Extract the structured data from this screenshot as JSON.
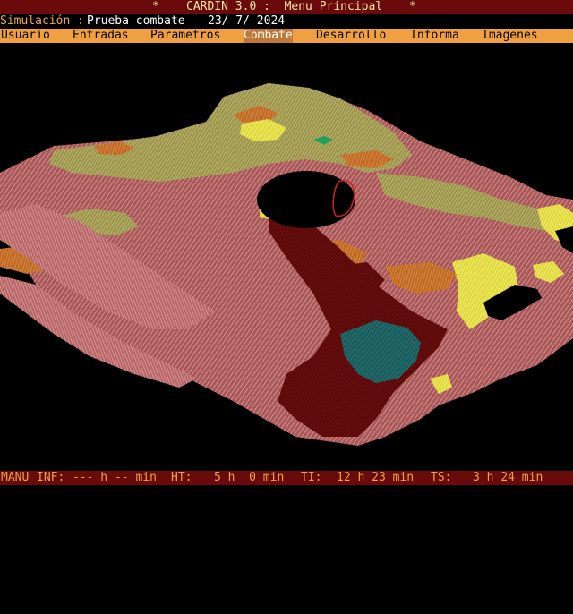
{
  "title_bar": {
    "left_marker": "*",
    "title": "CARDIN 3.0 :  Menu Principal",
    "right_marker": "*"
  },
  "simulation": {
    "label": "Simulación :",
    "name": "Prueba combate",
    "date": "23/ 7/ 2024"
  },
  "menu": {
    "items": [
      {
        "label": "Usuario"
      },
      {
        "label": "Entradas"
      },
      {
        "label": "Parametros"
      },
      {
        "label": "Combate",
        "active": true
      },
      {
        "label": "Desarrollo"
      },
      {
        "label": "Informa"
      },
      {
        "label": "Imagenes"
      }
    ]
  },
  "viewport": {
    "content": "3D wireframe terrain view",
    "colors": {
      "terrain_pink": "#c96a6a",
      "terrain_light_pink": "#e0a0a0",
      "terrain_dark_red": "#6a0a0a",
      "terrain_khaki": "#b8b060",
      "terrain_yellow": "#f5f060",
      "terrain_orange": "#d07820",
      "terrain_teal": "#207070",
      "terrain_green": "#20a060"
    }
  },
  "status": {
    "mode": "MANU",
    "inf_label": "INF:",
    "inf_value": "--- h -- min",
    "ht_label": "HT:",
    "ht_value": "5 h  0 min",
    "ti_label": "TI:",
    "ti_value": "12 h 23 min",
    "ts_label": "TS:",
    "ts_value": "3 h 24 min"
  },
  "palette": {
    "title_bg": "#6a0a0a",
    "title_fg": "#f1e7a6",
    "menu_bg": "#f0a040",
    "menu_active_bg": "#c07838",
    "status_fg": "#f0a040"
  }
}
